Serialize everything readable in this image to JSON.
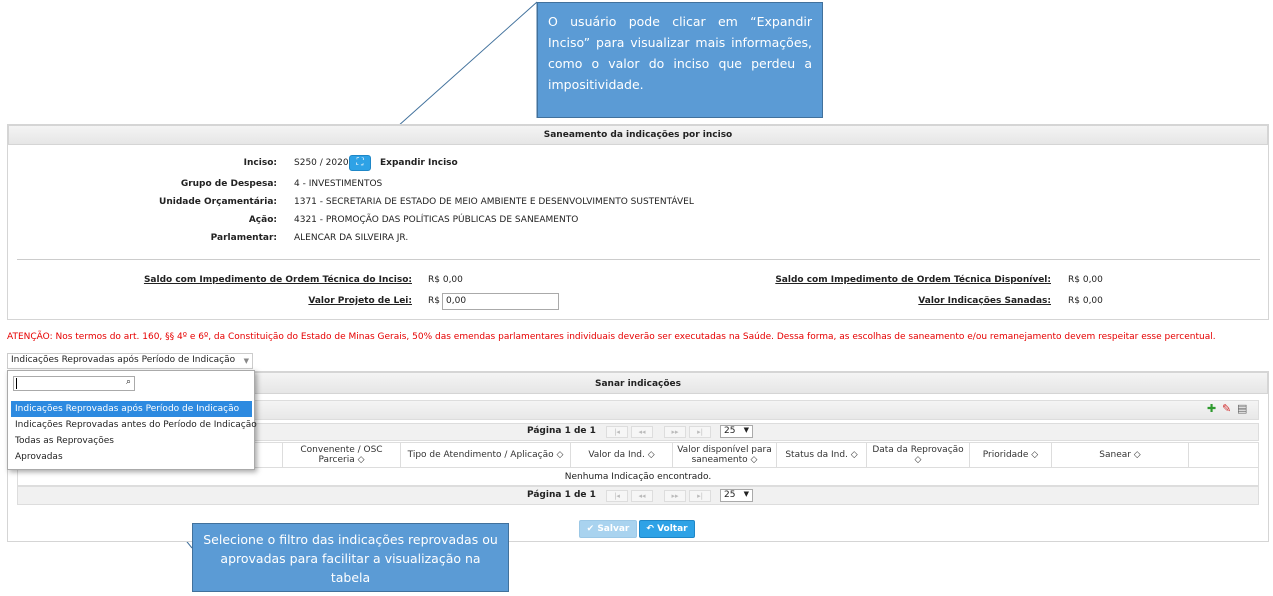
{
  "callouts": {
    "top": "O usuário pode clicar em “Expandir Inciso” para visualizar mais informações, como o valor do inciso que perdeu a impositividade.",
    "bottom": "Selecione o filtro das indicações reprovadas ou aprovadas para facilitar a visualização na tabela"
  },
  "panel1": {
    "title": "Saneamento da indicações por inciso",
    "inciso_label": "Inciso:",
    "inciso_value": "S250 / 2020",
    "expand_label": "Expandir Inciso",
    "grupo_label": "Grupo de Despesa:",
    "grupo_value": "4 - INVESTIMENTOS",
    "unidade_label": "Unidade Orçamentária:",
    "unidade_value": "1371 - SECRETARIA DE ESTADO DE MEIO AMBIENTE E DESENVOLVIMENTO SUSTENTÁVEL",
    "acao_label": "Ação:",
    "acao_value": "4321 - PROMOÇÃO DAS POLÍTICAS PÚBLICAS DE SANEAMENTO",
    "parlamentar_label": "Parlamentar:",
    "parlamentar_value": "ALENCAR DA SILVEIRA JR.",
    "saldo_inciso_label": "Saldo com Impedimento de Ordem Técnica do Inciso:",
    "saldo_inciso_value": "R$ 0,00",
    "valor_projeto_label": "Valor Projeto de Lei:",
    "valor_projeto_prefix": "R$",
    "valor_projeto_value": "0,00",
    "saldo_disp_label": "Saldo com Impedimento de Ordem Técnica Disponível:",
    "saldo_disp_value": "R$ 0,00",
    "valor_sanadas_label": "Valor Indicações Sanadas:",
    "valor_sanadas_value": "R$ 0,00"
  },
  "warning": "ATENÇÃO: Nos termos do art. 160, §§ 4º e 6º, da Constituição do Estado de Minas Gerais, 50% das emendas parlamentares individuais deverão ser executadas na Saúde. Dessa forma, as escolhas de saneamento e/ou remanejamento devem respeitar esse percentual.",
  "filter": {
    "selected": "Indicações Reprovadas após Período de Indicação",
    "search_value": "",
    "options": [
      "Indicações Reprovadas após Período de Indicação",
      "Indicações Reprovadas antes do Período de Indicação",
      "Todas as Reprovações",
      "Aprovadas"
    ]
  },
  "panel2": {
    "title": "Sanar indicações",
    "pagination_top": "Página 1 de 1",
    "pagination_bottom": "Página 1 de 1",
    "page_size": "25",
    "pager_first": "|◂",
    "pager_prev": "◂◂",
    "pager_next": "▸▸",
    "pager_last": "▸|",
    "empty_message": "Nenhuma Indicação encontrado.",
    "columns": [
      "Convenente / OSC Parceria ◇",
      "Tipo de Atendimento / Aplicação ◇",
      "Valor da Ind. ◇",
      "Valor disponível para saneamento ◇",
      "Status da Ind. ◇",
      "Data da Reprovação ◇",
      "Prioridade ◇",
      "Sanear ◇"
    ]
  },
  "buttons": {
    "salvar": "Salvar",
    "voltar": "Voltar"
  },
  "colors": {
    "callout": "#5b9bd5",
    "primary": "#2ea2e6",
    "warning": "#e60000",
    "selected_option": "#2d8ae0"
  }
}
